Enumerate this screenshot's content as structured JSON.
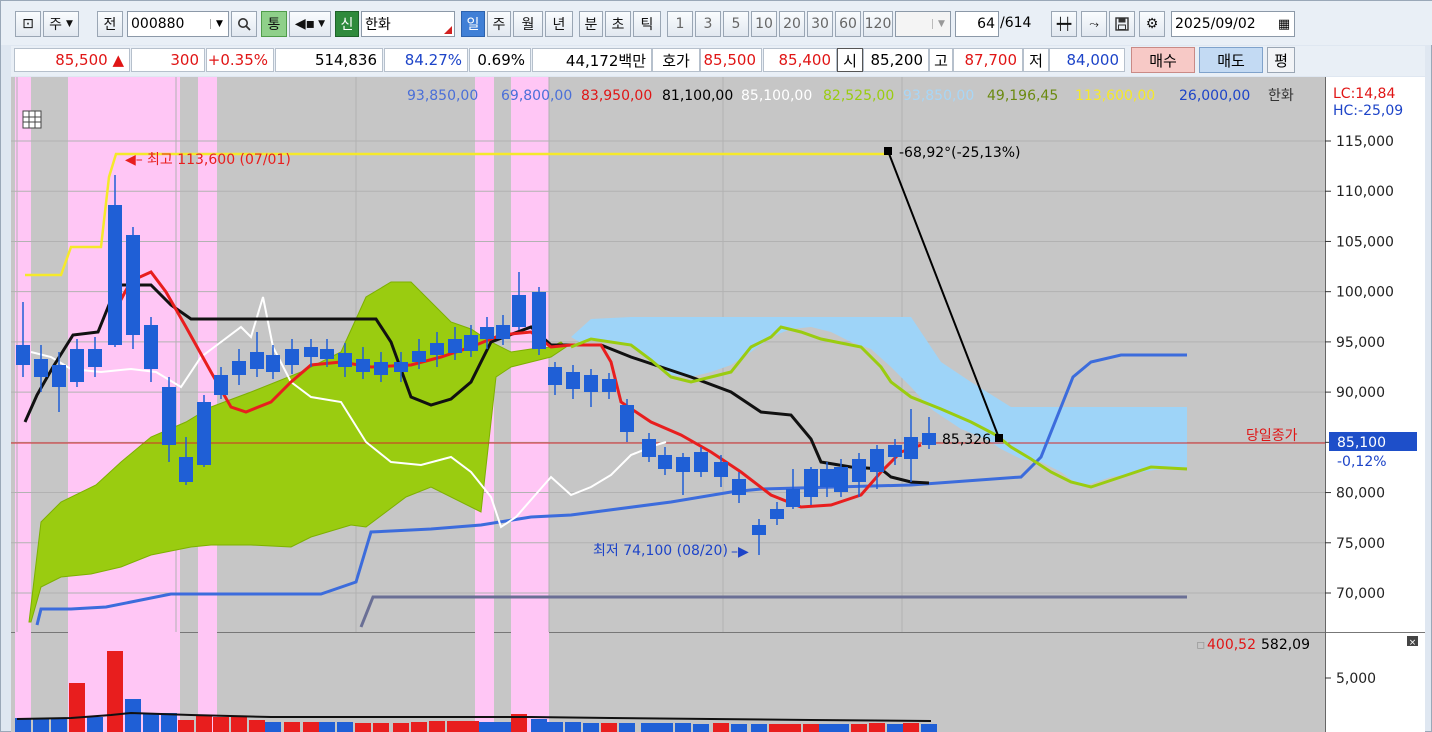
{
  "toolbar": {
    "period_label": "주",
    "prev_label": "전",
    "code": "000880",
    "sync_label": "통",
    "credit_label": "신",
    "stock_name": "한화",
    "periods": [
      "일",
      "주",
      "월",
      "년",
      "분",
      "초",
      "틱"
    ],
    "active_period": "일",
    "intervals": [
      "1",
      "3",
      "5",
      "10",
      "20",
      "30",
      "60",
      "120"
    ],
    "count": "64",
    "total": "/614",
    "date": "2025/09/02"
  },
  "quote": {
    "price": "85,500 ▲",
    "change": "300",
    "change_pct": "+0.35%",
    "volume": "514,836",
    "vol_ratio": "84.27%",
    "turnover": "0.69%",
    "amount": "44,172백만",
    "hoga_label": "호가",
    "ask": "85,500",
    "bid": "85,400",
    "open_label": "시",
    "open": "85,200",
    "high_label": "고",
    "high": "87,700",
    "low_label": "저",
    "low": "84,000",
    "buy_label": "매수",
    "sell_label": "매도",
    "eval_label": "평"
  },
  "legend": {
    "v1": "93,850,00",
    "v2": "69,800,00",
    "v3": "83,950,00",
    "v4": "81,100,00",
    "v5": "85,100,00",
    "v6": "82,525,00",
    "v7": "93,850,00",
    "v8": "49,196,45",
    "v9": "113,600,00",
    "v10": "26,000,00",
    "name": "한화",
    "lc": "LC:14,84",
    "hc": "HC:-25,09"
  },
  "annotations": {
    "high_note": "최고 113,600 (07/01)",
    "low_note": "최저 74,100 (08/20)",
    "trend_note": "-68,92°(-25,13%)",
    "point_note": "85,326",
    "close_label": "당일종가",
    "current_price": "85,100",
    "current_change": "-0,12%"
  },
  "volume_legend": {
    "v1": "400,52",
    "v2": "582,09"
  },
  "colors": {
    "up": "#e81e1e",
    "down": "#1f5fd6",
    "cloud_green": "#9acc10",
    "cloud_blue": "#9ed4f8",
    "highlight": "#ffc6f5",
    "price_bg": "#c6c6c6"
  },
  "chart_data": {
    "type": "candlestick",
    "ylim": [
      66000,
      118000
    ],
    "yticks": [
      "115,000",
      "110,000",
      "105,000",
      "100,000",
      "95,000",
      "90,000",
      "85,000",
      "80,000",
      "75,000",
      "70,000"
    ],
    "vol_ticks": [
      "5,000"
    ]
  }
}
